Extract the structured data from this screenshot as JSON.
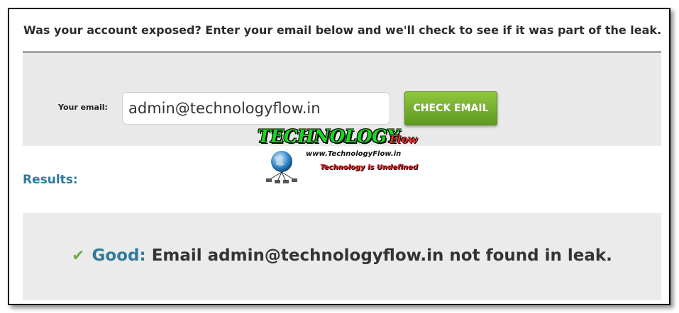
{
  "header": {
    "prompt": "Was your account exposed? Enter your email below and we'll check to see if it was part of the leak."
  },
  "form": {
    "email_label": "Your email:",
    "email_value": "admin@technologyflow.in",
    "check_button_label": "CHECK EMAIL"
  },
  "results": {
    "label": "Results:",
    "status_word": "Good:",
    "message": "Email admin@technologyflow.in not found in leak.",
    "status_icon": "checkmark-icon"
  },
  "watermark": {
    "title": "TECHNOLOGY",
    "title_suffix": "Flow",
    "url": "www.TechnologyFlow.in",
    "tagline": "Technology is Undefined"
  },
  "colors": {
    "accent_blue": "#2f7a9a",
    "button_green": "#6aa82b",
    "check_green": "#6ab04c",
    "panel_gray": "#e9e9e9"
  }
}
